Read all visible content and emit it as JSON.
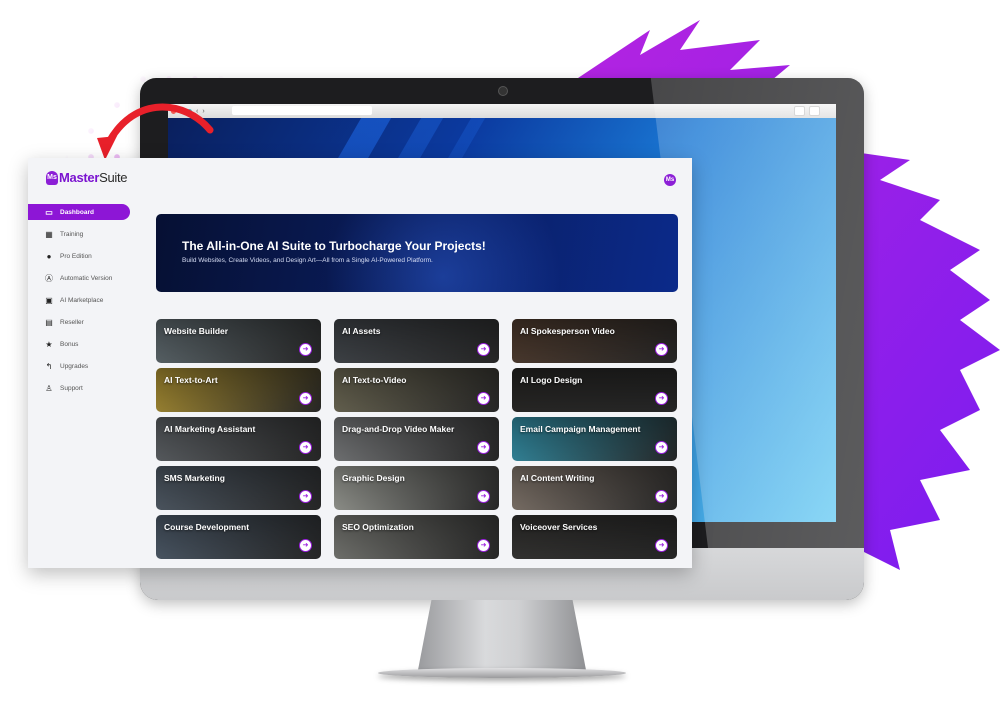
{
  "brand": {
    "name_a": "Master",
    "name_b": "Suite",
    "mark": "Ms",
    "accent": "#8d16d6"
  },
  "sidebar": {
    "items": [
      {
        "label": "Dashboard",
        "icon": "monitor-icon",
        "glyph": "▭",
        "active": true
      },
      {
        "label": "Training",
        "icon": "training-icon",
        "glyph": "▦",
        "active": false
      },
      {
        "label": "Pro Edition",
        "icon": "pro-badge-icon",
        "glyph": "●",
        "active": false
      },
      {
        "label": "Automatic Version",
        "icon": "automatic-icon",
        "glyph": "Ⓐ",
        "active": false
      },
      {
        "label": "AI Marketplace",
        "icon": "shopping-bag-icon",
        "glyph": "▣",
        "active": false
      },
      {
        "label": "Reseller",
        "icon": "reseller-icon",
        "glyph": "▤",
        "active": false
      },
      {
        "label": "Bonus",
        "icon": "star-icon",
        "glyph": "★",
        "active": false
      },
      {
        "label": "Upgrades",
        "icon": "upgrade-arrow-icon",
        "glyph": "↰",
        "active": false
      },
      {
        "label": "Support",
        "icon": "support-icon",
        "glyph": "♙",
        "active": false
      }
    ]
  },
  "header": {
    "profile_icon": "user-avatar-icon",
    "profile_glyph": "Ms"
  },
  "hero": {
    "title": "The All-in-One AI Suite to Turbocharge Your Projects!",
    "subtitle": "Build Websites, Create Videos, and Design Art—All from a Single AI-Powered Platform."
  },
  "tools": [
    {
      "label": "Website Builder",
      "bg": "#6d7a80"
    },
    {
      "label": "AI Assets",
      "bg": "#4a4f55"
    },
    {
      "label": "AI Spokesperson Video",
      "bg": "#5a4334"
    },
    {
      "label": "AI Text-to-Art",
      "bg": "#c8a83a"
    },
    {
      "label": "AI Text-to-Video",
      "bg": "#7f7a62"
    },
    {
      "label": "AI Logo Design",
      "bg": "#2b2a28"
    },
    {
      "label": "AI Marketing Assistant",
      "bg": "#6c7176"
    },
    {
      "label": "Drag-and-Drop Video Maker",
      "bg": "#8e9092"
    },
    {
      "label": "Email Campaign Management",
      "bg": "#3aa8c4"
    },
    {
      "label": "SMS Marketing",
      "bg": "#5d6a78"
    },
    {
      "label": "Graphic Design",
      "bg": "#b8bab2"
    },
    {
      "label": "AI Content Writing",
      "bg": "#9a8c80"
    },
    {
      "label": "Course Development",
      "bg": "#5a6a7c"
    },
    {
      "label": "SEO Optimization",
      "bg": "#8f908a"
    },
    {
      "label": "Voiceover Services",
      "bg": "#3b3a38"
    }
  ],
  "card_action_glyph": "➜",
  "browser": {
    "back": "‹",
    "forward": "›"
  }
}
